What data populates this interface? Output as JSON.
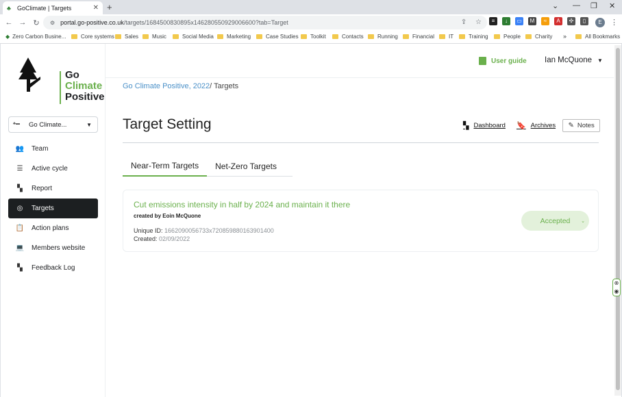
{
  "browser": {
    "tab_title": "GoClimate | Targets",
    "url_host": "portal.go-positive.co.uk",
    "url_path": "/targets/1684500830895x146280550929006600?tab=Target",
    "profile_initial": "E"
  },
  "bookmarks": [
    "Zero Carbon Busine...",
    "Core systems",
    "Sales",
    "Music",
    "Social Media",
    "Marketing",
    "Case Studies",
    "Toolkit",
    "Contacts",
    "Running",
    "Financial",
    "IT",
    "Training",
    "People",
    "Charity"
  ],
  "bookmarks_more": "»",
  "all_bookmarks": "All Bookmarks",
  "logo": {
    "line1": "Go",
    "line2": "Climate",
    "line3": "Positive"
  },
  "sidebar": {
    "org_select": "Go Climate...",
    "items": [
      {
        "label": "Team",
        "icon": "team-icon"
      },
      {
        "label": "Active cycle",
        "icon": "list-icon"
      },
      {
        "label": "Report",
        "icon": "report-icon"
      },
      {
        "label": "Targets",
        "icon": "target-icon",
        "active": true
      },
      {
        "label": "Action plans",
        "icon": "clipboard-icon"
      },
      {
        "label": "Members website",
        "icon": "laptop-icon"
      },
      {
        "label": "Feedback Log",
        "icon": "feedback-icon"
      }
    ]
  },
  "header": {
    "user_guide": "User guide",
    "user_name": "Ian McQuone"
  },
  "breadcrumb": {
    "parent": "Go Climate Positive, 2022",
    "separator": "/",
    "current": "Targets"
  },
  "page": {
    "title": "Target Setting",
    "dashboard": "Dashboard",
    "archives": "Archives",
    "notes": "Notes",
    "tabs": [
      "Near-Term Targets",
      "Net-Zero Targets"
    ],
    "active_tab": 0
  },
  "target": {
    "goal": "Cut emissions intensity in half by 2024 and maintain it there",
    "created_by": "created by Eoin McQuone",
    "unique_id_label": "Unique ID:",
    "unique_id": "1662090056733x720859880163901400",
    "created_label": "Created:",
    "created": "02/09/2022",
    "status": "Accepted"
  },
  "colors": {
    "brand_green": "#6ab04c",
    "link_blue": "#4a90c8",
    "active_nav": "#1c1f21"
  }
}
